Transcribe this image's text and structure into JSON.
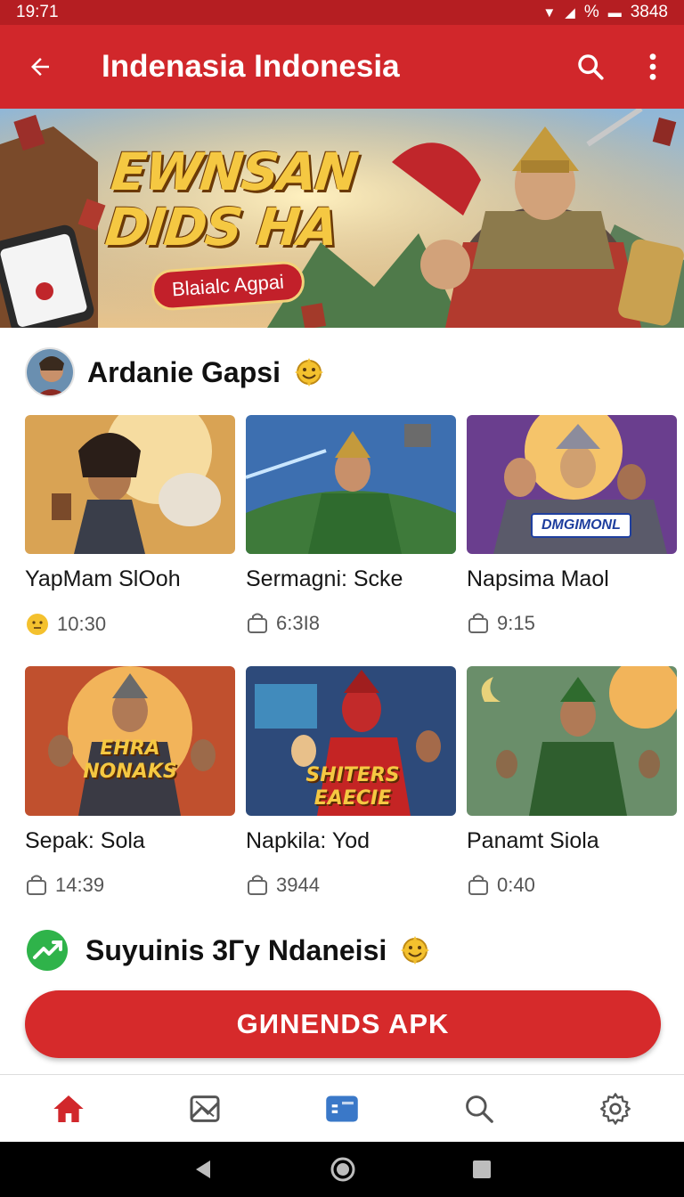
{
  "status_bar": {
    "time": "19:71",
    "battery": "%",
    "right_text": "3848"
  },
  "app_bar": {
    "title": "Indenasia Indonesia",
    "back_icon": "back-arrow-icon",
    "search_icon": "search-icon",
    "menu_icon": "more-vert-icon"
  },
  "banner": {
    "headline_line1": "EWNSAN",
    "headline_line2": "DIDS HA",
    "subtitle": "Blaialc Agpai"
  },
  "section1": {
    "title": "Ardanie Gapsi"
  },
  "cards_row1": [
    {
      "title": "YapMam SlOoh",
      "meta": "10:30",
      "meta_icon": "emoji-icon"
    },
    {
      "title": "Sermagni: Scke",
      "meta": "6:3I8",
      "meta_icon": "bag-icon"
    },
    {
      "title": "Napsima Maol",
      "meta": "9:15",
      "meta_icon": "bag-icon",
      "badge": "DMGIMONL"
    }
  ],
  "cards_row2": [
    {
      "title": "Sepak: Sola",
      "meta": "14:39",
      "meta_icon": "bag-icon",
      "overlay": "EHRA NONAKS"
    },
    {
      "title": "Napkila: Yod",
      "meta": "3944",
      "meta_icon": "bag-icon",
      "overlay": "SHITERS EAECIE"
    },
    {
      "title": "Panamt Siola",
      "meta": "0:40",
      "meta_icon": "bag-icon"
    }
  ],
  "section2": {
    "title": "Suyuinis 3Гy Ndaneisi"
  },
  "cta": {
    "label": "GИNENDS APK"
  },
  "colors": {
    "primary": "#d1272b",
    "status": "#b51e22",
    "accent_gold": "#f5c842"
  },
  "bottom_nav": [
    "home-icon",
    "gallery-icon",
    "media-icon",
    "search-icon",
    "settings-icon"
  ]
}
